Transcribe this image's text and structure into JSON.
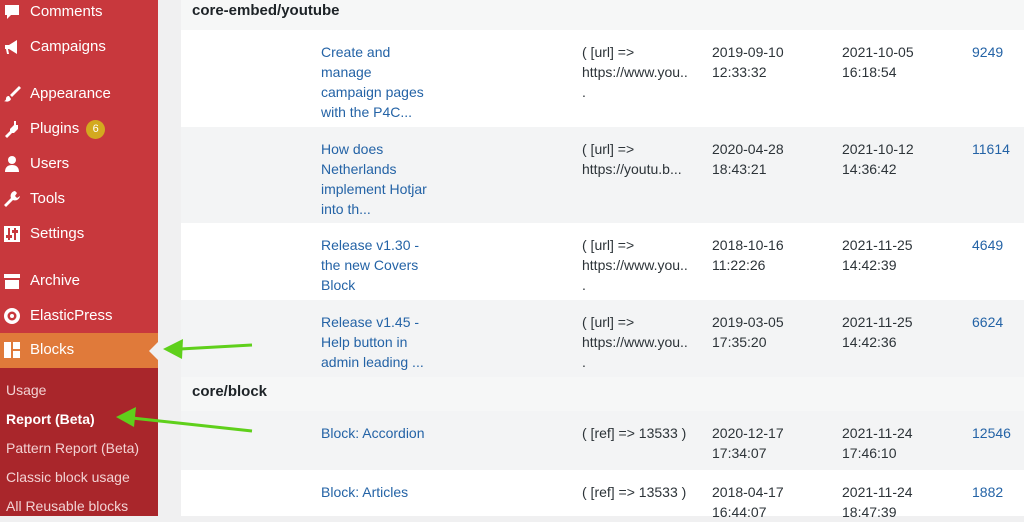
{
  "sidebar": {
    "items": [
      {
        "key": "comments",
        "label": "Comments",
        "icon": "comment-icon"
      },
      {
        "key": "campaigns",
        "label": "Campaigns",
        "icon": "megaphone-icon"
      },
      {
        "key": "appearance",
        "label": "Appearance",
        "icon": "paintbrush-icon"
      },
      {
        "key": "plugins",
        "label": "Plugins",
        "icon": "plugin-icon",
        "badge": "6"
      },
      {
        "key": "users",
        "label": "Users",
        "icon": "user-icon"
      },
      {
        "key": "tools",
        "label": "Tools",
        "icon": "wrench-icon"
      },
      {
        "key": "settings",
        "label": "Settings",
        "icon": "sliders-icon"
      },
      {
        "key": "archive",
        "label": "Archive",
        "icon": "archive-icon"
      },
      {
        "key": "elasticpress",
        "label": "ElasticPress",
        "icon": "elasticpress-icon"
      },
      {
        "key": "blocks",
        "label": "Blocks",
        "icon": "blocks-icon",
        "active": true
      }
    ],
    "submenu": [
      {
        "label": "Usage"
      },
      {
        "label": "Report (Beta)",
        "current": true
      },
      {
        "label": "Pattern Report (Beta)"
      },
      {
        "label": "Classic block usage"
      },
      {
        "label": "All Reusable blocks"
      }
    ]
  },
  "groups": [
    {
      "name": "core-embed/youtube",
      "rows": [
        {
          "title": [
            "Create and",
            "manage",
            "campaign pages",
            "with the P4C..."
          ],
          "attrs": [
            "( [url] =>",
            "https://www.you..",
            "."
          ],
          "created": [
            "2019-09-10",
            "12:33:32"
          ],
          "modified": [
            "2021-10-05",
            "16:18:54"
          ],
          "post_id": "9249"
        },
        {
          "title": [
            "How does",
            "Netherlands",
            "implement Hotjar",
            "into th..."
          ],
          "attrs": [
            "( [url] =>",
            "https://youtu.b..."
          ],
          "created": [
            "2020-04-28",
            "18:43:21"
          ],
          "modified": [
            "2021-10-12",
            "14:36:42"
          ],
          "post_id": "11614"
        },
        {
          "title": [
            "Release v1.30 -",
            "the new Covers",
            "Block"
          ],
          "attrs": [
            "( [url] =>",
            "https://www.you..",
            "."
          ],
          "created": [
            "2018-10-16",
            "11:22:26"
          ],
          "modified": [
            "2021-11-25",
            "14:42:39"
          ],
          "post_id": "4649"
        },
        {
          "title": [
            "Release v1.45 -",
            "Help button in",
            "admin leading ..."
          ],
          "attrs": [
            "( [url] =>",
            "https://www.you..",
            "."
          ],
          "created": [
            "2019-03-05",
            "17:35:20"
          ],
          "modified": [
            "2021-11-25",
            "14:42:36"
          ],
          "post_id": "6624"
        }
      ]
    },
    {
      "name": "core/block",
      "rows": [
        {
          "title": [
            "Block: Accordion"
          ],
          "attrs": [
            "( [ref] => 13533 )"
          ],
          "created": [
            "2020-12-17",
            "17:34:07"
          ],
          "modified": [
            "2021-11-24",
            "17:46:10"
          ],
          "post_id": "12546"
        },
        {
          "title": [
            "Block: Articles"
          ],
          "attrs": [
            "( [ref] => 13533 )"
          ],
          "created": [
            "2018-04-17",
            "16:44:07"
          ],
          "modified": [
            "2021-11-24",
            "18:47:39"
          ],
          "post_id": "1882"
        }
      ]
    }
  ],
  "colors": {
    "sidebar": "#c8383d",
    "active": "#e07a3a",
    "submenu": "#a9262b",
    "link": "#2463a6",
    "arrow": "#5fd01b",
    "badge": "#d3a91f"
  }
}
